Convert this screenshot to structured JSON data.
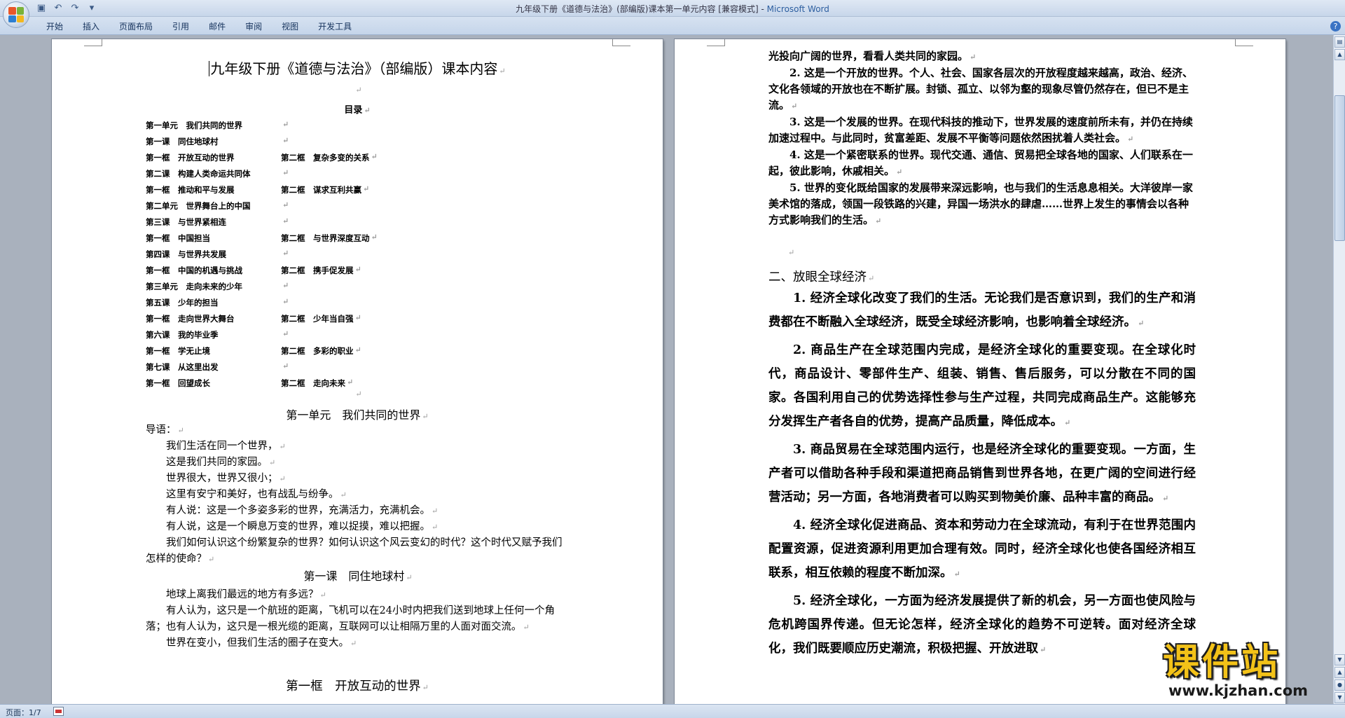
{
  "window": {
    "title": "九年级下册《道德与法治》(部编版)课本第一单元内容 [兼容模式] - ",
    "app_name": "Microsoft Word"
  },
  "quick_access": {
    "save_icon": "save-icon",
    "undo_icon": "undo-icon",
    "redo_icon": "redo-icon",
    "customize_icon": "customize-qat-icon"
  },
  "ribbon": {
    "tabs": [
      "开始",
      "插入",
      "页面布局",
      "引用",
      "邮件",
      "审阅",
      "视图",
      "开发工具"
    ]
  },
  "colors": {
    "accent": "#2d5fa0",
    "page_bg": "#ffffff",
    "workspace_bg": "#a9b1bd",
    "watermark_yellow": "#f3c218"
  },
  "left_page": {
    "title": "九年级下册《道德与法治》（部编版）课本内容",
    "toc_heading": "目录",
    "toc": [
      [
        "第一单元　我们共同的世界",
        ""
      ],
      [
        "第一课　同住地球村",
        ""
      ],
      [
        "第一框　开放互动的世界",
        "第二框　复杂多变的关系"
      ],
      [
        "第二课　构建人类命运共同体",
        ""
      ],
      [
        "第一框　推动和平与发展",
        "第二框　谋求互利共赢"
      ],
      [
        "第二单元　世界舞台上的中国",
        ""
      ],
      [
        "第三课　与世界紧相连",
        ""
      ],
      [
        "第一框　中国担当",
        "第二框　与世界深度互动"
      ],
      [
        "第四课　与世界共发展",
        ""
      ],
      [
        "第一框　中国的机遇与挑战",
        "第二框　携手促发展"
      ],
      [
        "第三单元　走向未来的少年",
        ""
      ],
      [
        "第五课　少年的担当",
        ""
      ],
      [
        "第一框　走向世界大舞台",
        "第二框　少年当自强"
      ],
      [
        "第六课　我的毕业季",
        ""
      ],
      [
        "第一框　学无止境",
        "第二框　多彩的职业"
      ],
      [
        "第七课　从这里出发",
        ""
      ],
      [
        "第一框　回望成长",
        "第二框　走向未来"
      ]
    ],
    "unit_heading": "第一单元　我们共同的世界",
    "intro_label": "导语：",
    "intro_lines": [
      "我们生活在同一个世界，",
      "这是我们共同的家园。",
      "世界很大，世界又很小；",
      "这里有安宁和美好，也有战乱与纷争。",
      "有人说：这是一个多姿多彩的世界，充满活力，充满机会。",
      "有人说，这是一个瞬息万变的世界，难以捉摸，难以把握。",
      "我们如何认识这个纷繁复杂的世界？如何认识这个风云变幻的时代？这个时代又赋予我们怎样的使命？"
    ],
    "lesson_heading": "第一课　同住地球村",
    "lesson_paragraphs": [
      "地球上离我们最远的地方有多远？",
      "有人认为，这只是一个航班的距离，飞机可以在24小时内把我们送到地球上任何一个角落；也有人认为，这只是一根光缆的距离，互联网可以让相隔万里的人面对面交流。",
      "世界在变小，但我们生活的圈子在变大。"
    ],
    "frame_heading": "第一框　开放互动的世界"
  },
  "right_page": {
    "top_lines": [
      "光投向广阔的世界，看看人类共同的家园。",
      "2. 这是一个开放的世界。个人、社会、国家各层次的开放程度越来越高，政治、经济、文化各领域的开放也在不断扩展。封锁、孤立、以邻为壑的现象尽管仍然存在，但已不是主流。",
      "3. 这是一个发展的世界。在现代科技的推动下，世界发展的速度前所未有，并仍在持续加速过程中。与此同时，贫富差距、发展不平衡等问题依然困扰着人类社会。",
      "4. 这是一个紧密联系的世界。现代交通、通信、贸易把全球各地的国家、人们联系在一起，彼此影响，休戚相关。",
      "5. 世界的变化既给国家的发展带来深远影响，也与我们的生活息息相关。大洋彼岸一家美术馆的落成，领国一段铁路的兴建，异国一场洪水的肆虐……世界上发生的事情会以各种方式影响我们的生活。"
    ],
    "section_heading": "二、放眼全球经济",
    "paragraphs": [
      "1. 经济全球化改变了我们的生活。无论我们是否意识到，我们的生产和消费都在不断融入全球经济，既受全球经济影响，也影响着全球经济。",
      "2. 商品生产在全球范围内完成，是经济全球化的重要变现。在全球化时代，商品设计、零部件生产、组装、销售、售后服务，可以分散在不同的国家。各国利用自己的优势选择性参与生产过程，共同完成商品生产。这能够充分发挥生产者各自的优势，提高产品质量，降低成本。",
      "3. 商品贸易在全球范围内运行，也是经济全球化的重要变现。一方面，生产者可以借助各种手段和渠道把商品销售到世界各地，在更广阔的空间进行经营活动；另一方面，各地消费者可以购买到物美价廉、品种丰富的商品。",
      "4. 经济全球化促进商品、资本和劳动力在全球流动，有利于在世界范围内配置资源，促进资源利用更加合理有效。同时，经济全球化也使各国经济相互联系，相互依赖的程度不断加深。",
      "5. 经济全球化，一方面为经济发展提供了新的机会，另一方面也使风险与危机跨国界传递。但无论怎样，经济全球化的趋势不可逆转。面对经济全球化，我们既要顺应历史潮流，积极把握、开放进取"
    ]
  },
  "status_bar": {
    "page_info": "页面：1/7"
  },
  "watermark": {
    "title": "课件站",
    "url": "www.kjzhan.com"
  }
}
